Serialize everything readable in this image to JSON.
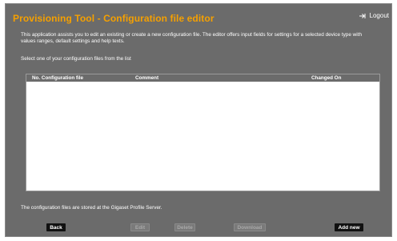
{
  "header": {
    "title": "Provisioning Tool - Configuration file editor",
    "logout_label": "Logout",
    "accent_color": "#f5a000"
  },
  "intro": {
    "description": "This application assists you to edit an existing or create a new configuration file. The editor offers input fields for settings for a selected device type with values ranges, default settings and help texts.",
    "select_label": "Select one of your configuration files from the list"
  },
  "table": {
    "columns": [
      "No. Configuration file",
      "Comment",
      "Changed On"
    ],
    "rows": []
  },
  "footer": {
    "note": "The configuration files are stored at the Gigaset Profile Server."
  },
  "buttons": {
    "back": "Back",
    "edit": "Edit",
    "delete": "Delete",
    "download": "Download",
    "add_new": "Add new"
  },
  "icons": {
    "logout": "logout-arrow-icon"
  }
}
